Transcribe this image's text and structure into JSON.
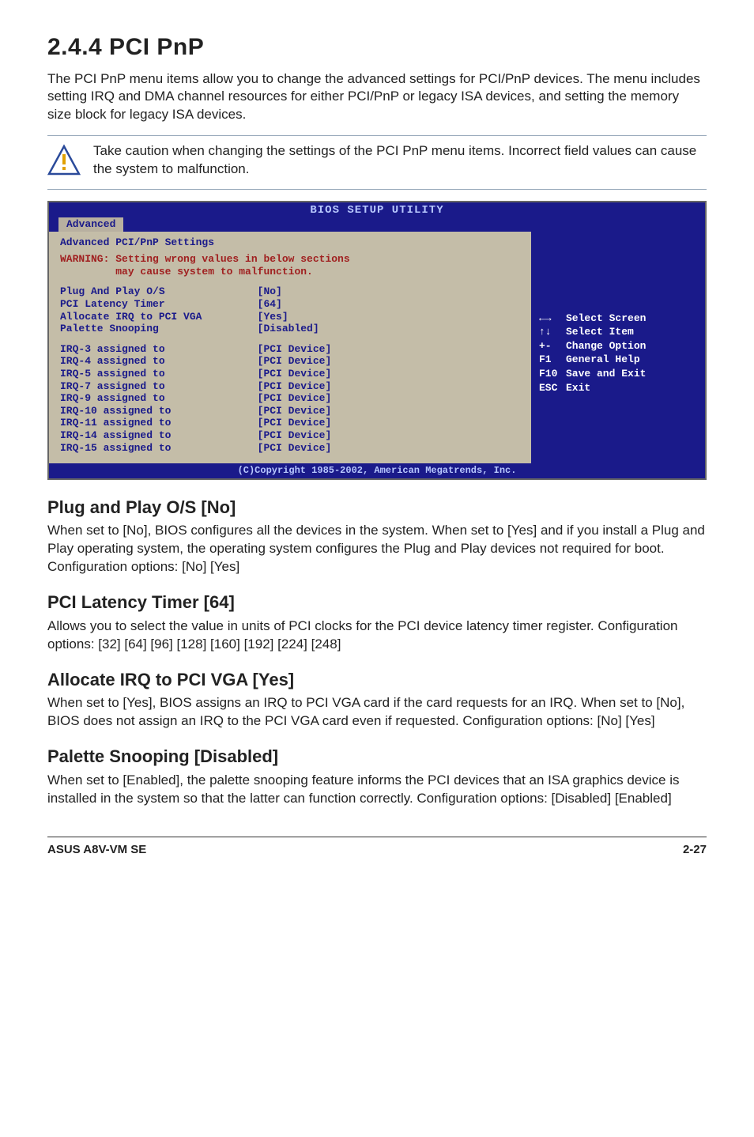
{
  "heading": "2.4.4  PCI PnP",
  "intro": "The PCI PnP menu items allow you to change the advanced settings for PCI/PnP devices. The menu includes setting IRQ and DMA channel resources for either PCI/PnP or legacy ISA devices, and setting the memory size block for legacy ISA devices.",
  "caution": "Take caution when changing the settings of the PCI PnP menu items. Incorrect field values can cause the system to malfunction.",
  "bios": {
    "title": "BIOS SETUP UTILITY",
    "tab": "Advanced",
    "section_title": "Advanced PCI/PnP Settings",
    "warning_line1": "WARNING: Setting wrong values in below sections",
    "warning_line2": "         may cause system to malfunction.",
    "rows": [
      {
        "label": "Plug And Play O/S",
        "value": "[No]"
      },
      {
        "label": "PCI Latency Timer",
        "value": "[64]"
      },
      {
        "label": "Allocate IRQ to PCI VGA",
        "value": "[Yes]"
      },
      {
        "label": "Palette Snooping",
        "value": "[Disabled]"
      }
    ],
    "irq_rows": [
      {
        "label": "IRQ-3 assigned to",
        "value": "[PCI Device]"
      },
      {
        "label": "IRQ-4 assigned to",
        "value": "[PCI Device]"
      },
      {
        "label": "IRQ-5 assigned to",
        "value": "[PCI Device]"
      },
      {
        "label": "IRQ-7 assigned to",
        "value": "[PCI Device]"
      },
      {
        "label": "IRQ-9 assigned to",
        "value": "[PCI Device]"
      },
      {
        "label": "IRQ-10 assigned to",
        "value": "[PCI Device]"
      },
      {
        "label": "IRQ-11 assigned to",
        "value": "[PCI Device]"
      },
      {
        "label": "IRQ-14 assigned to",
        "value": "[PCI Device]"
      },
      {
        "label": "IRQ-15 assigned to",
        "value": "[PCI Device]"
      }
    ],
    "hints": [
      {
        "sym": "←→",
        "text": "Select Screen"
      },
      {
        "sym": "↑↓",
        "text": "Select Item"
      },
      {
        "sym": "+-",
        "text": "Change Option"
      },
      {
        "sym": "F1",
        "text": "General Help"
      },
      {
        "sym": "F10",
        "text": "Save and Exit"
      },
      {
        "sym": "ESC",
        "text": "Exit"
      }
    ],
    "footer": "(C)Copyright 1985-2002, American Megatrends, Inc."
  },
  "sections": {
    "plug_title": "Plug and Play O/S [No]",
    "plug_body": "When set to [No], BIOS configures all the devices in the system. When set to [Yes] and if you install a Plug and Play operating system, the operating system configures the Plug and Play devices not required for boot. Configuration options: [No] [Yes]",
    "latency_title": "PCI Latency Timer [64]",
    "latency_body": "Allows you to select the value in units of PCI clocks for the PCI device latency timer register. Configuration options: [32] [64] [96] [128] [160] [192] [224] [248]",
    "irqvga_title": "Allocate IRQ to PCI VGA [Yes]",
    "irqvga_body": "When set to [Yes], BIOS assigns an IRQ to PCI VGA card if the card requests for an IRQ. When set to [No], BIOS does not assign an IRQ to the PCI VGA card even if requested. Configuration options: [No] [Yes]",
    "palette_title": "Palette Snooping [Disabled]",
    "palette_body": "When set to [Enabled], the palette snooping feature informs the PCI devices that an ISA graphics device is installed in the system so that the latter can function correctly. Configuration options: [Disabled] [Enabled]"
  },
  "footer": {
    "left": "ASUS A8V-VM SE",
    "right": "2-27"
  }
}
